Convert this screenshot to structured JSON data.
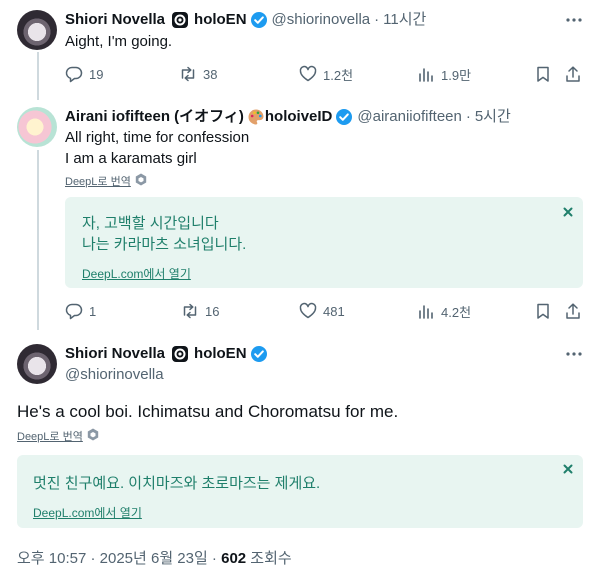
{
  "tweets": [
    {
      "name": "Shiori Novella",
      "org": "holoEN",
      "handle": "@shiorinovella",
      "time": "11시간",
      "text": "Aight, I'm going.",
      "replies": "19",
      "retweets": "38",
      "likes": "1.2천",
      "views": "1.9만"
    },
    {
      "name": "Airani iofifteen (イオフィ)",
      "org": "holoiveID",
      "handle": "@airaniiofifteen",
      "time": "5시간",
      "text_line1": "All right, time for confession",
      "text_line2": "I am a karamats girl",
      "deepl_label": "DeepL로 번역",
      "translation_line1": "자, 고백할 시간입니다",
      "translation_line2": "나는 카라마츠 소녀입니다.",
      "open_in_deepl": "DeepL.com에서 열기",
      "replies": "1",
      "retweets": "16",
      "likes": "481",
      "views": "4.2천"
    }
  ],
  "main": {
    "name": "Shiori Novella",
    "org": "holoEN",
    "handle": "@shiorinovella",
    "text": "He's a cool boi. Ichimatsu and Choromatsu for me.",
    "deepl_label": "DeepL로 번역",
    "translation": "멋진 친구예요. 이치마즈와 초로마즈는 제게요.",
    "open_in_deepl": "DeepL.com에서 열기",
    "timestamp": "오후 10:57 · 2025년 6월 23일 · ",
    "views_count": "602",
    "views_label": " 조회수"
  },
  "colors": {
    "verified": "#1d9bf0",
    "translation_bg": "#e8f5f1",
    "translation_text": "#1f7f6b",
    "thread_line": "#cfd9de"
  }
}
